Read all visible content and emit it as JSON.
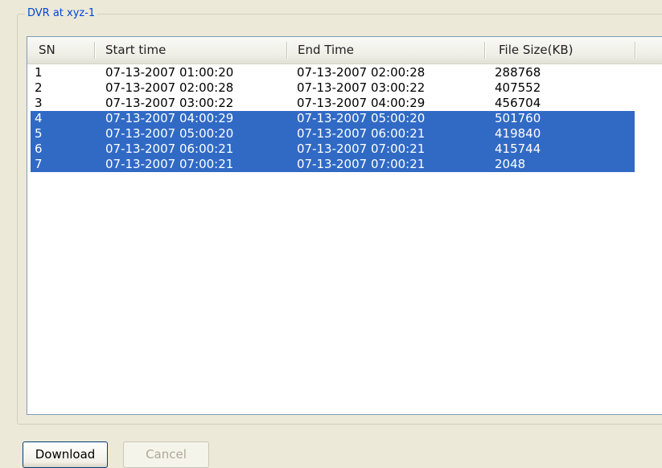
{
  "window": {
    "group_title": "DVR at xyz-1"
  },
  "list": {
    "columns": [
      "SN",
      "Start time",
      "End Time",
      "File Size(KB)"
    ],
    "rows": [
      {
        "sn": "1",
        "start": "07-13-2007 01:00:20",
        "end": "07-13-2007 02:00:28",
        "size": "288768",
        "selected": false
      },
      {
        "sn": "2",
        "start": "07-13-2007 02:00:28",
        "end": "07-13-2007 03:00:22",
        "size": "407552",
        "selected": false
      },
      {
        "sn": "3",
        "start": "07-13-2007 03:00:22",
        "end": "07-13-2007 04:00:29",
        "size": "456704",
        "selected": false
      },
      {
        "sn": "4",
        "start": "07-13-2007 04:00:29",
        "end": "07-13-2007 05:00:20",
        "size": "501760",
        "selected": true
      },
      {
        "sn": "5",
        "start": "07-13-2007 05:00:20",
        "end": "07-13-2007 06:00:21",
        "size": "419840",
        "selected": true
      },
      {
        "sn": "6",
        "start": "07-13-2007 06:00:21",
        "end": "07-13-2007 07:00:21",
        "size": "415744",
        "selected": true
      },
      {
        "sn": "7",
        "start": "07-13-2007 07:00:21",
        "end": "07-13-2007 07:00:21",
        "size": "2048",
        "selected": true
      }
    ]
  },
  "buttons": {
    "download_label": "Download",
    "cancel_label": "Cancel"
  },
  "colors": {
    "selection": "#316ac5",
    "caption": "#0046d5",
    "face": "#ece9d8"
  }
}
